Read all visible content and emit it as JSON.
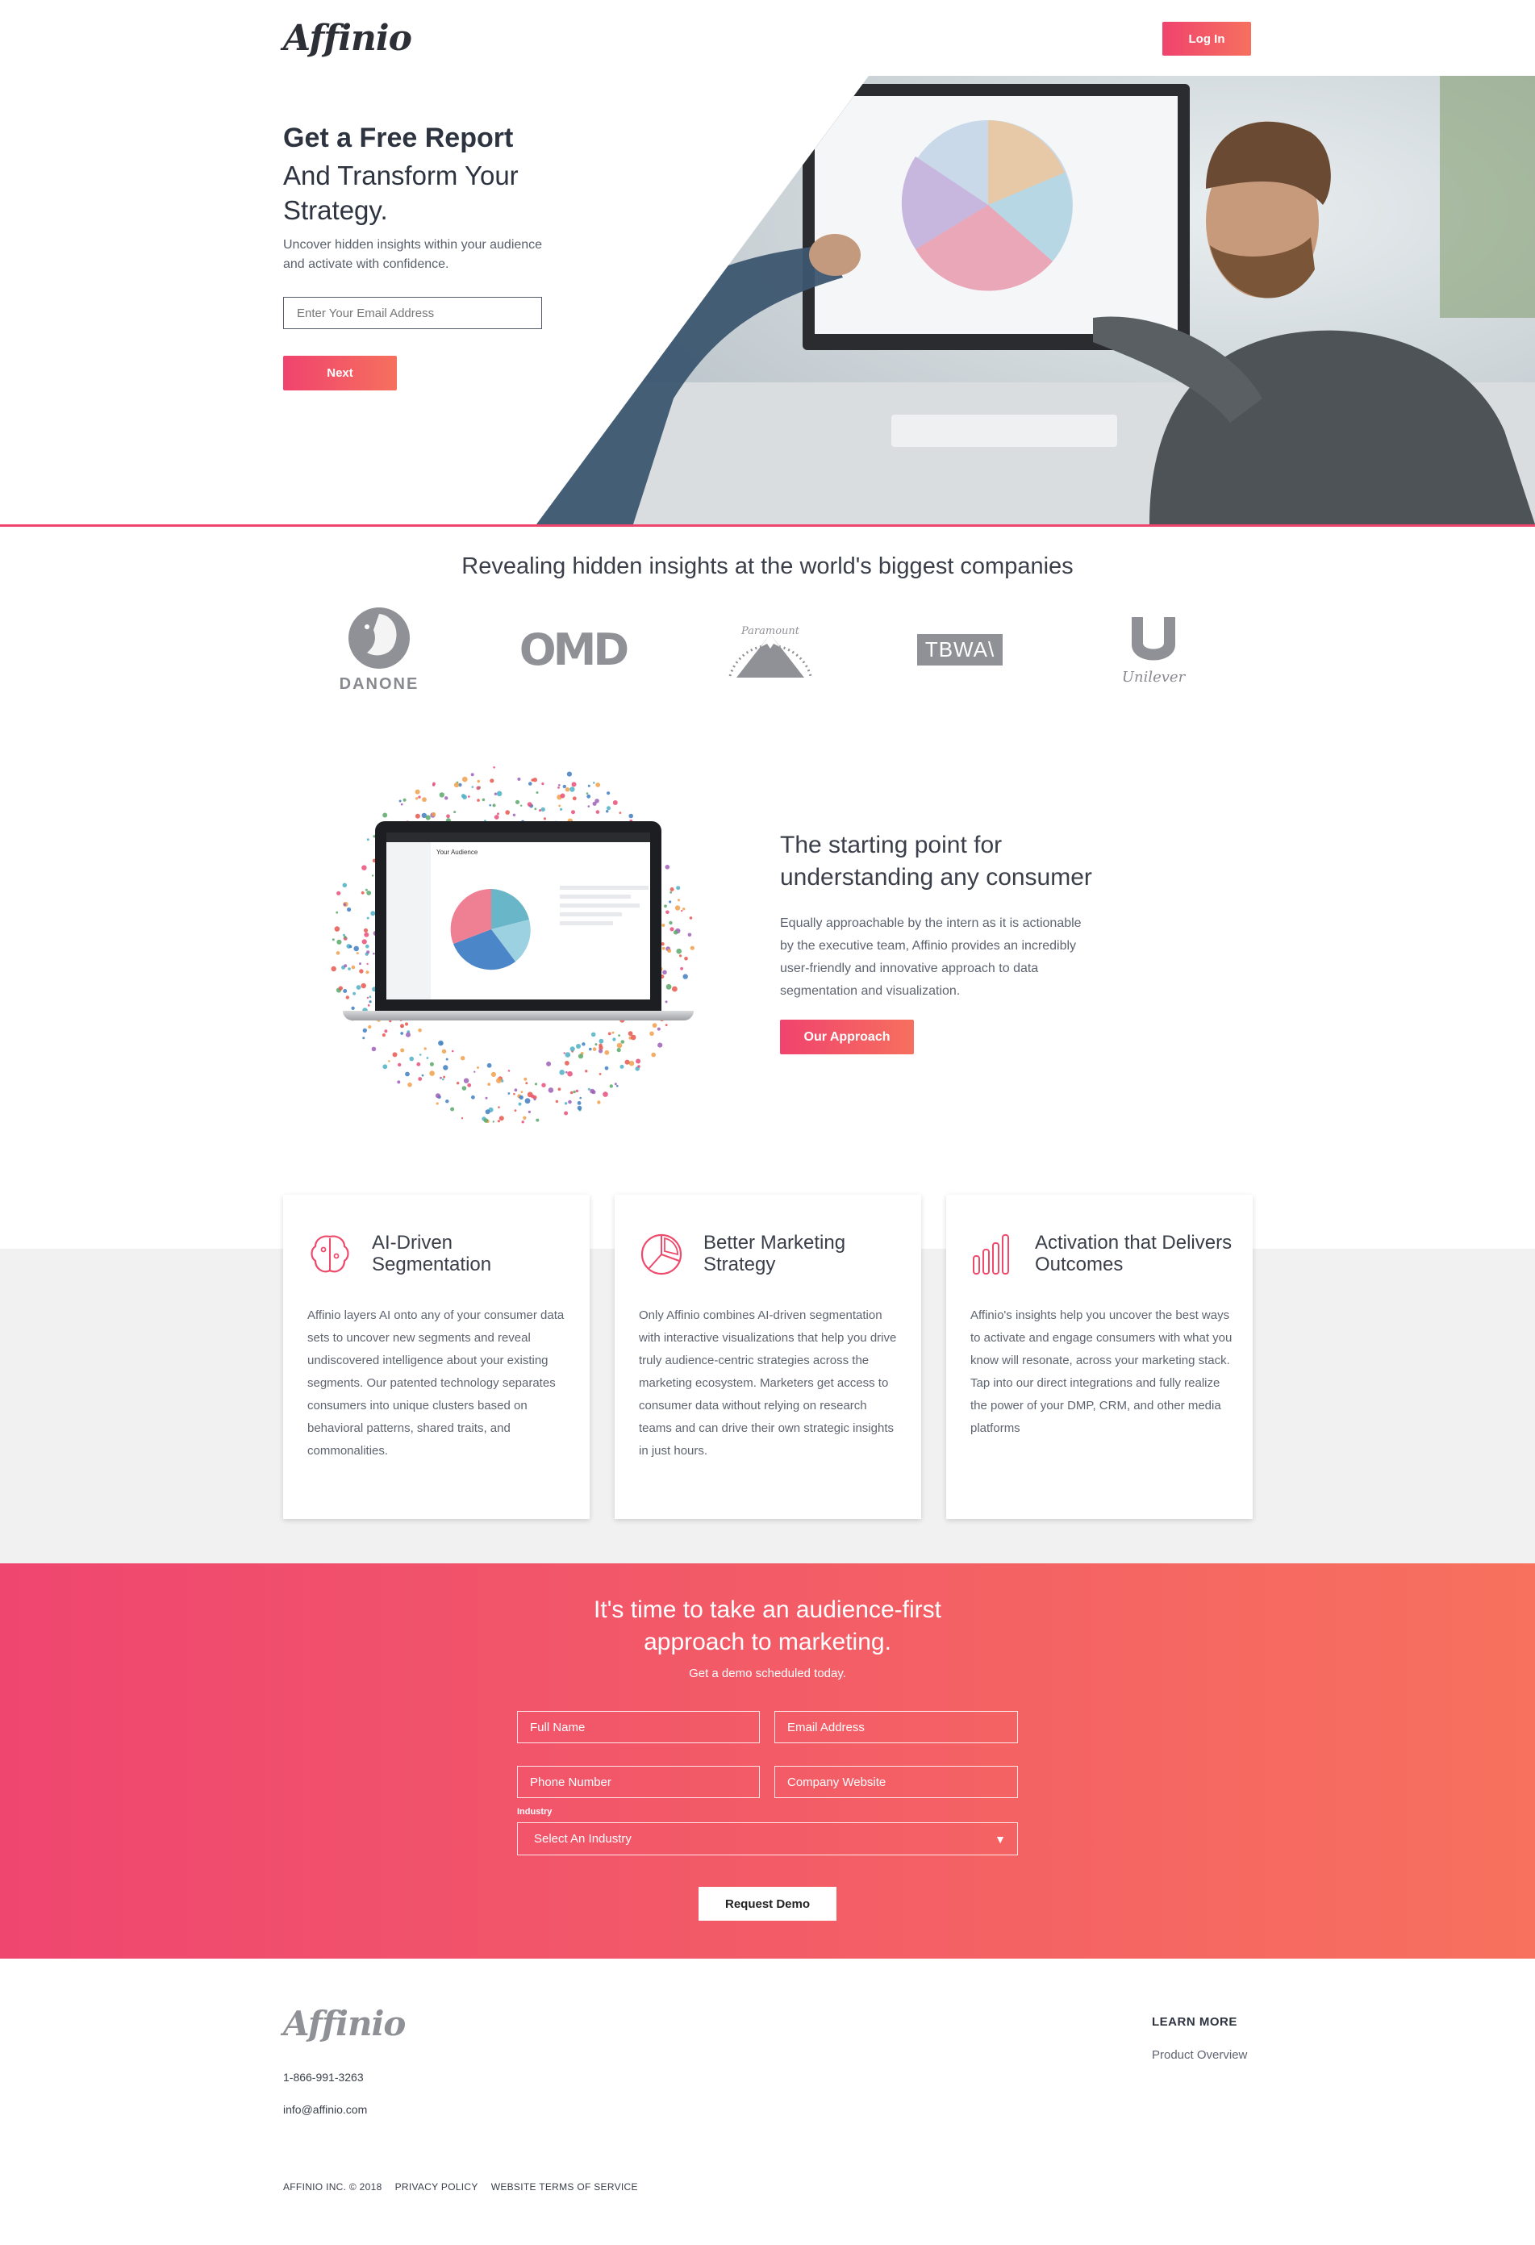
{
  "brand": {
    "logo": "Affinio",
    "accent": "#f0436e",
    "accent_end": "#f6705e"
  },
  "header": {
    "login_label": "Log In"
  },
  "hero": {
    "title": "Get a Free Report",
    "subtitle": "And Transform Your Strategy.",
    "description": "Uncover hidden insights within your audience and activate with confidence.",
    "email_placeholder": "Enter Your Email Address",
    "next_label": "Next"
  },
  "clients": {
    "title": "Revealing hidden insights at the world's biggest companies",
    "logos": [
      "DANONE",
      "OMD",
      "Paramount",
      "TBWA\\",
      "Unilever"
    ]
  },
  "approach": {
    "title": "The starting point for understanding any consumer",
    "description": "Equally approachable by the intern as it is actionable by the executive team, Affinio provides an incredibly user-friendly and innovative approach to data segmentation and visualization.",
    "button_label": "Our Approach",
    "laptop_screen": {
      "heading": "Your Audience"
    }
  },
  "features": [
    {
      "icon": "brain-icon",
      "title": "AI-Driven Segmentation",
      "text": "Affinio layers AI onto any of your consumer data sets to uncover new segments and reveal undiscovered intelligence about your existing segments. Our patented technology separates consumers into unique clusters based on behavioral patterns, shared traits, and commonalities."
    },
    {
      "icon": "pie-chart-icon",
      "title": "Better Marketing Strategy",
      "text": "Only Affinio combines AI-driven segmentation with interactive visualizations that help you drive truly audience-centric strategies across the marketing ecosystem. Marketers get access to consumer data without relying on research teams and can drive their own strategic insights in just hours."
    },
    {
      "icon": "bar-chart-icon",
      "title": "Activation that Delivers Outcomes",
      "text": "Affinio's insights help you uncover the best ways to activate and engage consumers with what you know will resonate, across your marketing stack. Tap into our direct integrations and fully realize the power of your DMP, CRM, and other media platforms"
    }
  ],
  "cta": {
    "title": "It's time to take an audience-first approach to marketing.",
    "subtitle": "Get a demo scheduled today.",
    "full_name": "Full Name",
    "email": "Email Address",
    "phone": "Phone Number",
    "website": "Company Website",
    "industry_label": "Industry",
    "industry_selected": "Select An Industry",
    "submit_label": "Request Demo"
  },
  "footer": {
    "logo": "Affinio",
    "phone": "1-866-991-3263",
    "email": "info@affinio.com",
    "learn_more": "LEARN MORE",
    "product_overview": "Product Overview",
    "copyright": "AFFINIO INC. © 2018",
    "privacy": "PRIVACY POLICY",
    "terms": "WEBSITE TERMS OF SERVICE"
  }
}
